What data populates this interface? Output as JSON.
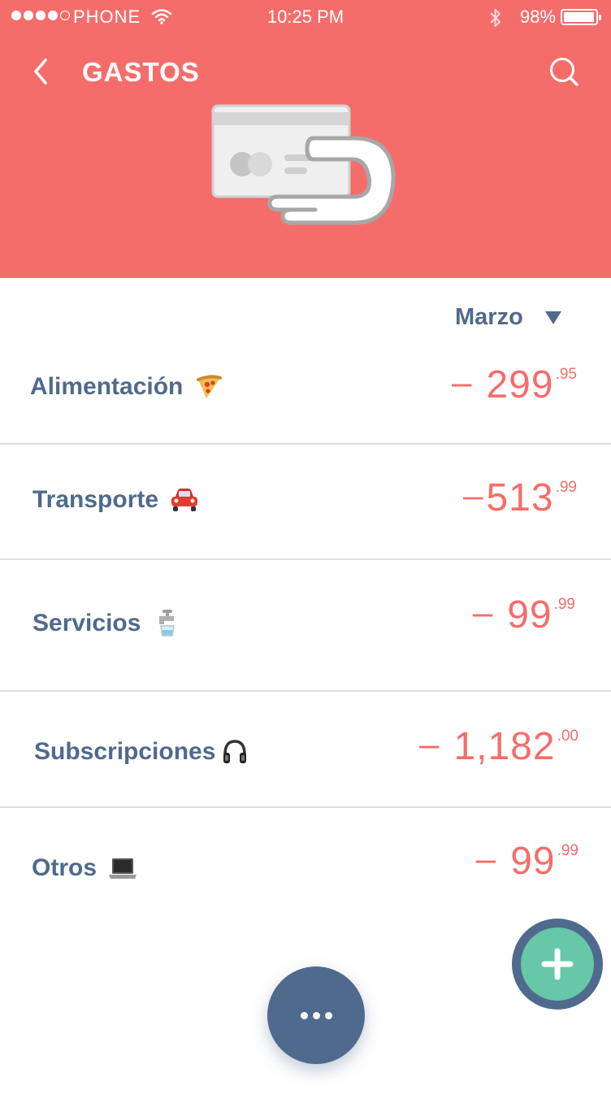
{
  "status_bar": {
    "carrier": "PHONE",
    "time": "10:25 PM",
    "battery": "98%",
    "battery_level": 0.98
  },
  "header": {
    "title": "GASTOS",
    "back_icon": "chevron-left-icon",
    "search_icon": "search-icon",
    "illustration": "card-payment-icon"
  },
  "month_selector": {
    "label": "Marzo",
    "icon": "triangle-down-icon"
  },
  "categories": [
    {
      "name": "Alimentación",
      "emoji": "pizza-icon",
      "sign": "–",
      "integer": "299",
      "decimal": ".95"
    },
    {
      "name": "Transporte",
      "emoji": "car-icon",
      "sign": "–",
      "integer": "513",
      "decimal": ".99"
    },
    {
      "name": "Servicios",
      "emoji": "faucet-icon",
      "sign": "–",
      "integer": "99",
      "decimal": ".99"
    },
    {
      "name": "Subscripciones",
      "emoji": "headphones-icon",
      "sign": "–",
      "integer": "1,182",
      "decimal": ".00"
    },
    {
      "name": "Otros",
      "emoji": "laptop-icon",
      "sign": "–",
      "integer": "99",
      "decimal": ".99"
    }
  ],
  "fabs": {
    "more_icon": "more-horizontal-icon",
    "add_icon": "plus-icon"
  },
  "colors": {
    "header": "#f56d6b",
    "text_primary": "#4f6a8c",
    "amount": "#f56d6b",
    "accent_green": "#67c7a9"
  }
}
